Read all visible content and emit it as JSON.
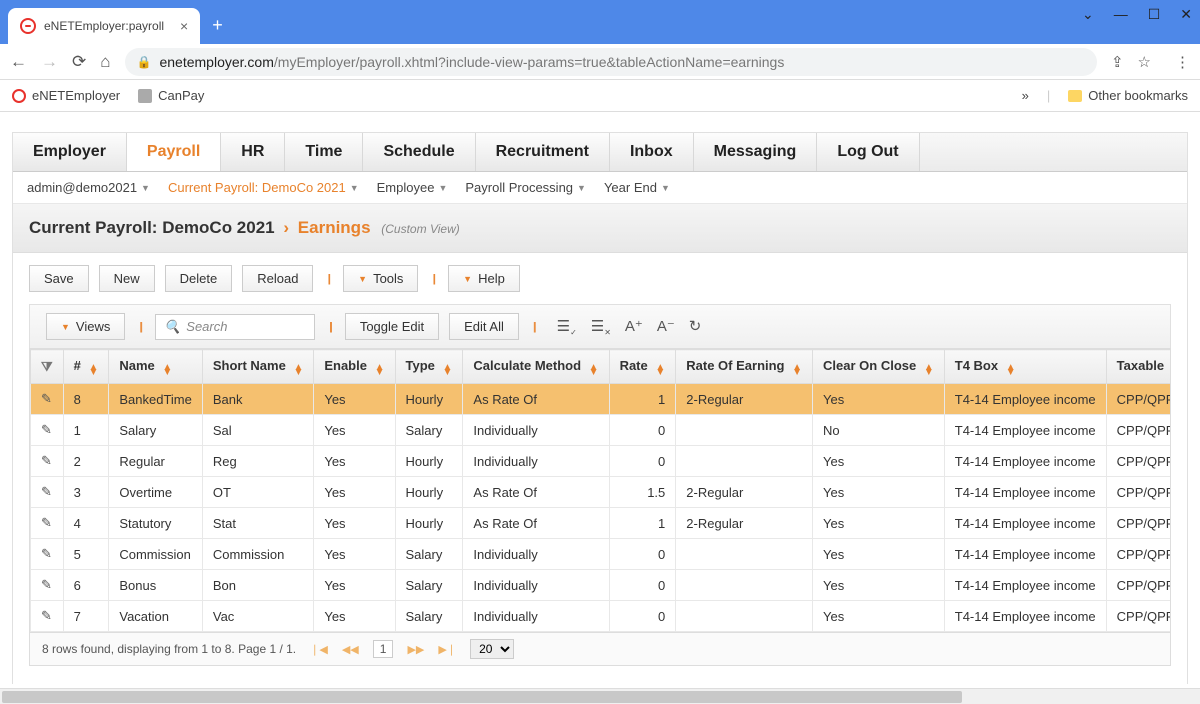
{
  "browser": {
    "tab_title": "eNETEmployer:payroll",
    "url_domain": "enetemployer.com",
    "url_path": "/myEmployer/payroll.xhtml?include-view-params=true&tableActionName=earnings",
    "bookmarks": [
      "eNETEmployer",
      "CanPay"
    ],
    "other_bookmarks": "Other bookmarks"
  },
  "tabs": [
    "Employer",
    "Payroll",
    "HR",
    "Time",
    "Schedule",
    "Recruitment",
    "Inbox",
    "Messaging",
    "Log Out"
  ],
  "active_tab_index": 1,
  "subnav": {
    "user": "admin@demo2021",
    "payroll": "Current Payroll: DemoCo 2021",
    "items": [
      "Employee",
      "Payroll Processing",
      "Year End"
    ]
  },
  "heading": {
    "title": "Current Payroll: DemoCo 2021",
    "section": "Earnings",
    "view": "(Custom View)"
  },
  "toolbar": {
    "save": "Save",
    "new": "New",
    "delete": "Delete",
    "reload": "Reload",
    "tools": "Tools",
    "help": "Help"
  },
  "tbl_ctrl": {
    "views": "Views",
    "search_placeholder": "Search",
    "toggle_edit": "Toggle Edit",
    "edit_all": "Edit All"
  },
  "columns": [
    "",
    "#",
    "Name",
    "Short Name",
    "Enable",
    "Type",
    "Calculate Method",
    "Rate",
    "Rate Of Earning",
    "Clear On Close",
    "T4 Box",
    "Taxable"
  ],
  "rows": [
    {
      "n": "8",
      "name": "BankedTime",
      "short": "Bank",
      "enable": "Yes",
      "type": "Hourly",
      "calc": "As Rate Of",
      "rate": "1",
      "roe": "2-Regular",
      "clr": "Yes",
      "t4": "T4-14 Employee income",
      "tax": "CPP/QPP, EI, EI",
      "sel": true
    },
    {
      "n": "1",
      "name": "Salary",
      "short": "Sal",
      "enable": "Yes",
      "type": "Salary",
      "calc": "Individually",
      "rate": "0",
      "roe": "",
      "clr": "No",
      "t4": "T4-14 Employee income",
      "tax": "CPP/QPP, EI, EI"
    },
    {
      "n": "2",
      "name": "Regular",
      "short": "Reg",
      "enable": "Yes",
      "type": "Hourly",
      "calc": "Individually",
      "rate": "0",
      "roe": "",
      "clr": "Yes",
      "t4": "T4-14 Employee income",
      "tax": "CPP/QPP, EI, EI"
    },
    {
      "n": "3",
      "name": "Overtime",
      "short": "OT",
      "enable": "Yes",
      "type": "Hourly",
      "calc": "As Rate Of",
      "rate": "1.5",
      "roe": "2-Regular",
      "clr": "Yes",
      "t4": "T4-14 Employee income",
      "tax": "CPP/QPP, EI, EI"
    },
    {
      "n": "4",
      "name": "Statutory",
      "short": "Stat",
      "enable": "Yes",
      "type": "Hourly",
      "calc": "As Rate Of",
      "rate": "1",
      "roe": "2-Regular",
      "clr": "Yes",
      "t4": "T4-14 Employee income",
      "tax": "CPP/QPP, EI, EI"
    },
    {
      "n": "5",
      "name": "Commission",
      "short": "Commission",
      "enable": "Yes",
      "type": "Salary",
      "calc": "Individually",
      "rate": "0",
      "roe": "",
      "clr": "Yes",
      "t4": "T4-14 Employee income",
      "tax": "CPP/QPP, EI, EI"
    },
    {
      "n": "6",
      "name": "Bonus",
      "short": "Bon",
      "enable": "Yes",
      "type": "Salary",
      "calc": "Individually",
      "rate": "0",
      "roe": "",
      "clr": "Yes",
      "t4": "T4-14 Employee income",
      "tax": "CPP/QPP, EI, EI"
    },
    {
      "n": "7",
      "name": "Vacation",
      "short": "Vac",
      "enable": "Yes",
      "type": "Salary",
      "calc": "Individually",
      "rate": "0",
      "roe": "",
      "clr": "Yes",
      "t4": "T4-14 Employee income",
      "tax": "CPP/QPP, EI, EI"
    }
  ],
  "pager": {
    "status": "8 rows found, displaying from 1 to 8. Page 1 / 1.",
    "page": "1",
    "page_size": "20"
  }
}
